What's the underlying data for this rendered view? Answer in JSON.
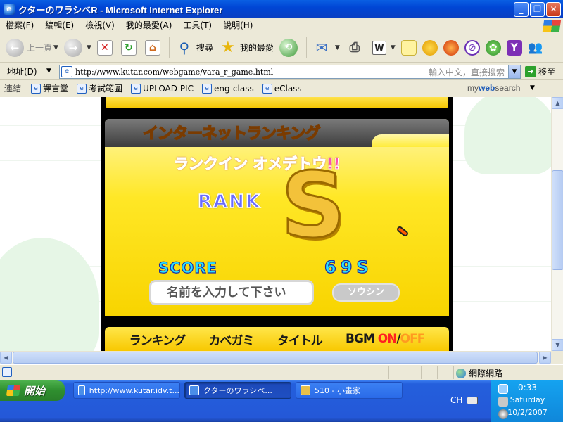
{
  "window": {
    "title": "クターのワラシベR - Microsoft Internet Explorer",
    "minimize": "_",
    "maximize": "❐",
    "close": "✕"
  },
  "menu": [
    "檔案(F)",
    "編輯(E)",
    "檢視(V)",
    "我的最愛(A)",
    "工具(T)",
    "說明(H)"
  ],
  "toolbar": {
    "back_label": "上一頁",
    "search_label": "搜尋",
    "favorites_label": "我的最愛"
  },
  "address": {
    "label": "地址(D)",
    "url": "http://www.kutar.com/webgame/vara_r_game.html",
    "search_hint": "輸入中文，直接搜索",
    "go_label": "移至"
  },
  "links": {
    "label": "連結",
    "items": [
      "譯言堂",
      "考試範圍",
      "UPLOAD PIC",
      "eng-class",
      "eClass"
    ],
    "mywebsearch_prefix": "my",
    "mywebsearch_brand": "web",
    "mywebsearch_suffix": "search"
  },
  "game": {
    "panel_title": "インターネットランキング",
    "congrats": "ランクイン オメデトウ!!",
    "rank_label": "RANK",
    "rank_value": "S",
    "score_label": "SCORE",
    "score_value": "69S",
    "name_placeholder": "名前を入力して下さい",
    "send_label": "ソウシン",
    "footer": {
      "ranking": "ランキング",
      "wallpaper": "カベガミ",
      "title": "タイトル",
      "bgm": "BGM",
      "on": "ON",
      "slash": "/",
      "off": "OFF"
    }
  },
  "status": {
    "zone": "網際網路"
  },
  "taskbar": {
    "start_label": "開始",
    "tasks": [
      {
        "label": "http://www.kutar.idv.t..."
      },
      {
        "label": "クターのワラシベ..."
      },
      {
        "label": "510 - 小畫家"
      }
    ],
    "language": "CH",
    "time": "0:33",
    "day": "Saturday",
    "date": "10/2/2007"
  }
}
